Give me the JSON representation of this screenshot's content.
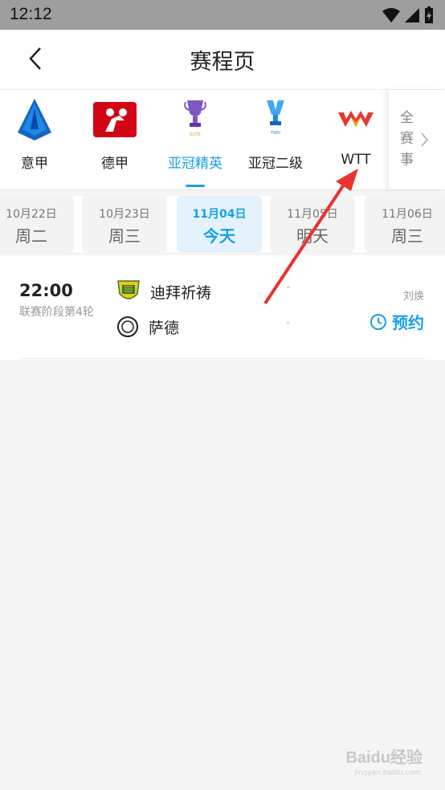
{
  "status_bar": {
    "time": "12:12"
  },
  "header": {
    "title": "赛程页"
  },
  "leagues": [
    {
      "name": "意甲",
      "active": false
    },
    {
      "name": "德甲",
      "active": false
    },
    {
      "name": "亚冠精英",
      "active": true
    },
    {
      "name": "亚冠二级",
      "active": false
    },
    {
      "name": "WTT",
      "active": false
    }
  ],
  "all_events": {
    "label_1": "全",
    "label_2": "赛",
    "label_3": "事"
  },
  "dates": [
    {
      "date": "10月22日",
      "weekday": "周二",
      "active": false
    },
    {
      "date": "10月23日",
      "weekday": "周三",
      "active": false
    },
    {
      "date": "11月04日",
      "weekday": "今天",
      "active": true
    },
    {
      "date": "11月05日",
      "weekday": "明天",
      "active": false
    },
    {
      "date": "11月06日",
      "weekday": "周三",
      "active": false
    }
  ],
  "match": {
    "time": "22:00",
    "stage": "联赛阶段第4轮",
    "home_team": "迪拜祈祷",
    "away_team": "萨德",
    "home_score": "-",
    "away_score": "-",
    "commentator": "刘焕",
    "reserve_label": "预约"
  },
  "colors": {
    "accent": "#1a9fe6",
    "arrow": "#e8332f"
  },
  "watermark": {
    "text": "Baidu经验",
    "sub": "jingyan.baidu.com"
  }
}
